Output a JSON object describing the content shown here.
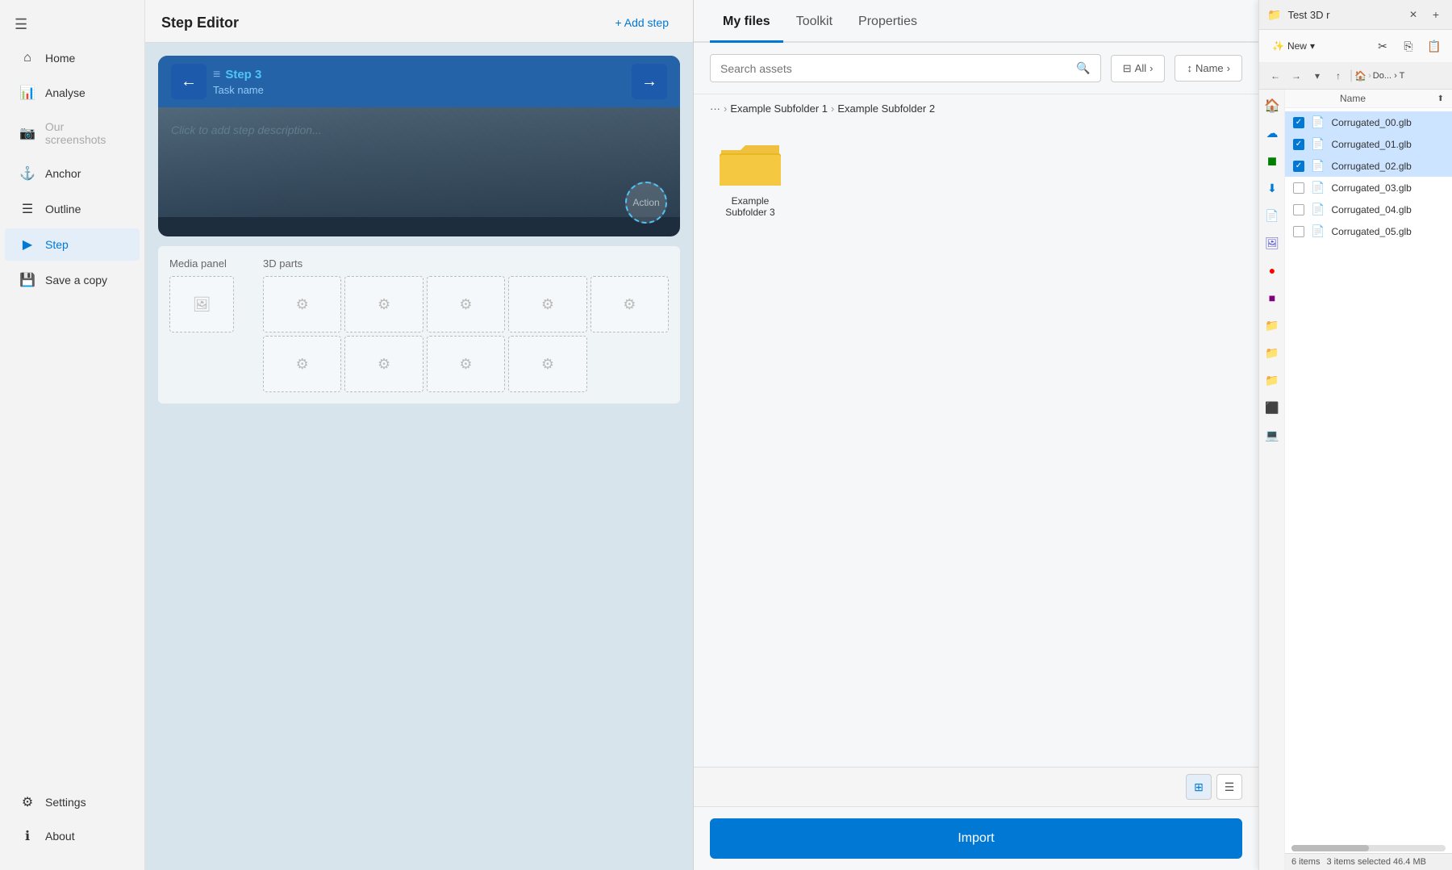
{
  "sidebar": {
    "menu_icon": "☰",
    "items": [
      {
        "id": "home",
        "label": "Home",
        "icon": "⌂",
        "active": false
      },
      {
        "id": "analyse",
        "label": "Analyse",
        "icon": "📊",
        "active": false
      },
      {
        "id": "our-screenshots",
        "label": "Our screenshots",
        "icon": "📷",
        "active": false,
        "disabled": true
      },
      {
        "id": "anchor",
        "label": "Anchor",
        "icon": "⚓",
        "active": false
      },
      {
        "id": "outline",
        "label": "Outline",
        "icon": "☰",
        "active": false
      },
      {
        "id": "step",
        "label": "Step",
        "icon": "▶",
        "active": true
      },
      {
        "id": "save-copy",
        "label": "Save a copy",
        "icon": "💾",
        "active": false
      }
    ],
    "bottom_items": [
      {
        "id": "settings",
        "label": "Settings",
        "icon": "⚙"
      },
      {
        "id": "about",
        "label": "About",
        "icon": "ℹ"
      }
    ]
  },
  "step_editor": {
    "title": "Step Editor",
    "add_step_label": "+ Add step",
    "step": {
      "name": "Step 3",
      "task_name": "Task name",
      "description_placeholder": "Click to add step description...",
      "action_label": "Action"
    },
    "media_panel": {
      "title": "Media panel",
      "placeholder_icon": "🖼"
    },
    "parts_panel": {
      "title": "3D parts",
      "placeholder_icon": "⚙"
    }
  },
  "file_browser": {
    "tabs": [
      {
        "id": "my-files",
        "label": "My files",
        "active": true
      },
      {
        "id": "toolkit",
        "label": "Toolkit",
        "active": false
      },
      {
        "id": "properties",
        "label": "Properties",
        "active": false
      }
    ],
    "search": {
      "placeholder": "Search assets",
      "search_icon": "🔍"
    },
    "filter": {
      "label": "All",
      "icon": "▼"
    },
    "sort": {
      "label": "Name",
      "icon": "↕"
    },
    "breadcrumb": {
      "dots": "···",
      "items": [
        "Example Subfolder 1",
        "Example Subfolder 2"
      ]
    },
    "folder": {
      "name": "Example Subfolder 3"
    },
    "import_label": "Import"
  },
  "windows_explorer": {
    "title": "Test 3D r",
    "new_label": "New",
    "nav_path": "Do... › T",
    "column_header": "Name",
    "files": [
      {
        "name": "Corrugated_00.glb",
        "checked": true
      },
      {
        "name": "Corrugated_01.glb",
        "checked": true
      },
      {
        "name": "Corrugated_02.glb",
        "checked": true
      },
      {
        "name": "Corrugated_03.glb",
        "checked": false
      },
      {
        "name": "Corrugated_04.glb",
        "checked": false
      },
      {
        "name": "Corrugated_05.glb",
        "checked": false
      }
    ],
    "status": {
      "items_count": "6 items",
      "selected_info": "3 items selected  46.4 MB"
    }
  },
  "view_toggle": {
    "grid_icon": "⊞",
    "list_icon": "☰"
  }
}
